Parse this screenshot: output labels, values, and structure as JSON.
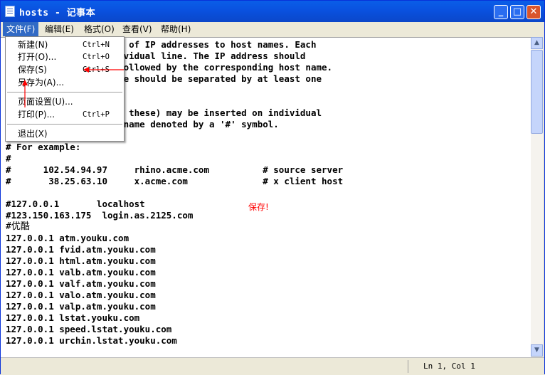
{
  "window": {
    "title": "hosts - 记事本"
  },
  "titlebar_buttons": {
    "minimize": "_",
    "maximize": "□",
    "close": "✕"
  },
  "menu": [
    "文件(F)",
    "编辑(E)",
    "格式(O)",
    "查看(V)",
    "帮助(H)"
  ],
  "file_menu": {
    "new": {
      "label": "新建(N)",
      "shortcut": "Ctrl+N"
    },
    "open": {
      "label": "打开(O)...",
      "shortcut": "Ctrl+O"
    },
    "save": {
      "label": "保存(S)",
      "shortcut": "Ctrl+S"
    },
    "save_as": {
      "label": "另存为(A)..."
    },
    "page_setup": {
      "label": "页面设置(U)..."
    },
    "print": {
      "label": "打印(P)...",
      "shortcut": "Ctrl+P"
    },
    "exit": {
      "label": "退出(X)"
    }
  },
  "editor_lines": [
    "          the mappings of IP addresses to host names. Each",
    "          t on an individual line. The IP address should",
    "          rst column followed by the corresponding host name.",
    "          the host name should be separated by at least one",
    "",
    "",
    "          nts (such as these) may be inserted on individual",
    "          the machine name denoted by a '#' symbol.",
    "",
    "# For example:",
    "#",
    "#      102.54.94.97     rhino.acme.com          # source server",
    "#       38.25.63.10     x.acme.com              # x client host",
    "",
    "#127.0.0.1       localhost",
    "#123.150.163.175  login.as.2125.com",
    "#优酷",
    "127.0.0.1 atm.youku.com",
    "127.0.0.1 fvid.atm.youku.com",
    "127.0.0.1 html.atm.youku.com",
    "127.0.0.1 valb.atm.youku.com",
    "127.0.0.1 valf.atm.youku.com",
    "127.0.0.1 valo.atm.youku.com",
    "127.0.0.1 valp.atm.youku.com",
    "127.0.0.1 lstat.youku.com",
    "127.0.0.1 speed.lstat.youku.com",
    "127.0.0.1 urchin.lstat.youku.com"
  ],
  "annotation": {
    "text": "保存!",
    "color": "#ff0000"
  },
  "status": {
    "position": "Ln 1, Col 1"
  },
  "colors": {
    "titlebar": "#0a51df",
    "menu_highlight": "#316ac5",
    "annotation": "#ff0000"
  }
}
